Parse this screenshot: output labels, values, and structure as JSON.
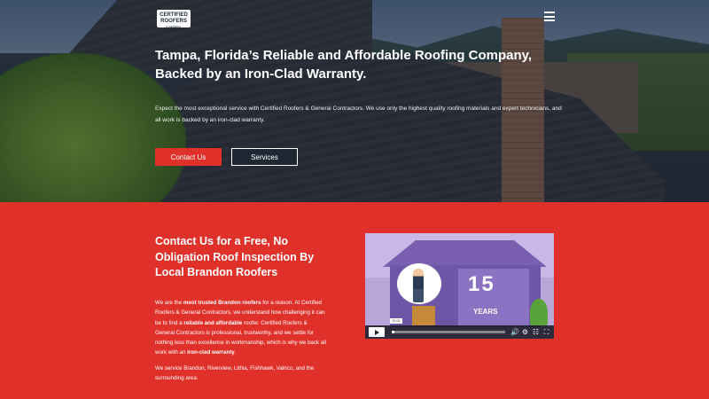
{
  "header": {
    "logo_line1": "CERTIFIED",
    "logo_line2": "ROOFERS",
    "logo_line3": "& GENERAL CONTRACTORS, INC.",
    "menu_icon": "hamburger-menu-icon"
  },
  "hero": {
    "title": "Tampa, Florida’s Reliable and Affordable Roofing Company, Backed by an Iron-Clad Warranty.",
    "description": "Expect the most exceptional service with Certified Roofers & General Contractors. We use only the highest quality roofing materials and expert technicians, and all work is backed by an iron-clad warranty.",
    "contact_button": "Contact Us",
    "services_button": "Services"
  },
  "section": {
    "title": "Contact Us for a Free, No Obligation Roof Inspection By Local Brandon Roofers",
    "p1_a": "We are the ",
    "p1_b": "most trusted Brandon roofers",
    "p1_c": " for a reason. At Certified Roofers & General Contractors, we understand how challenging it can be to find a ",
    "p1_d": "reliable and affordable",
    "p1_e": " roofer. Certified Roofers & General Contractors is professional, trustworthy, and we settle for nothing less than excellence in workmanship, which is why we back all work with an ",
    "p1_f": "iron-clad warranty",
    "p1_g": ".",
    "p2": "We service Brandon, Riverview, Lithia, Fishhawk, Valrico, and the surrounding area."
  },
  "video": {
    "number": "15",
    "years": "YEARS",
    "badge": "21:00",
    "progress": 0.02
  },
  "colors": {
    "brand_red": "#e0302a",
    "dark": "#1f2733"
  }
}
